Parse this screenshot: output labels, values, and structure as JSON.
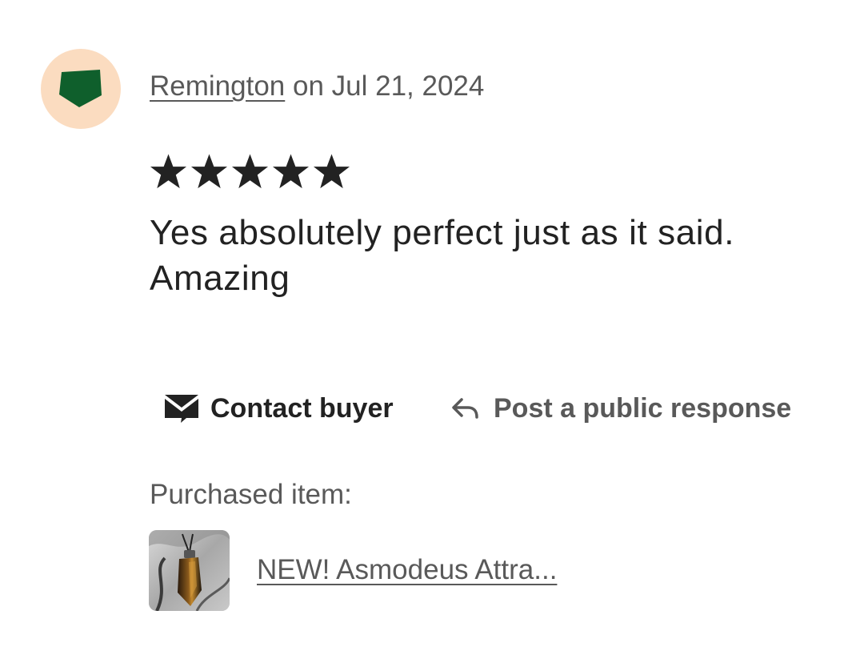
{
  "review": {
    "reviewer_name": "Remington",
    "date_text": " on Jul 21, 2024",
    "rating": 5,
    "rating_max": 5,
    "text": "Yes absolutely perfect just as it said. Amazing",
    "avatar_icon": "pentagon-avatar-icon",
    "colors": {
      "avatar_bg": "#fbdcc0",
      "avatar_shape": "#0f5f2c",
      "star": "#222222",
      "muted_text": "#595959"
    }
  },
  "actions": {
    "contact_label": "Contact buyer",
    "contact_icon": "envelope-icon",
    "respond_label": "Post a public response",
    "respond_icon": "reply-arrow-icon"
  },
  "purchase": {
    "label": "Purchased item:",
    "item_title": "NEW! Asmodeus Attra...",
    "thumbnail_icon": "crystal-pendant-thumbnail"
  }
}
